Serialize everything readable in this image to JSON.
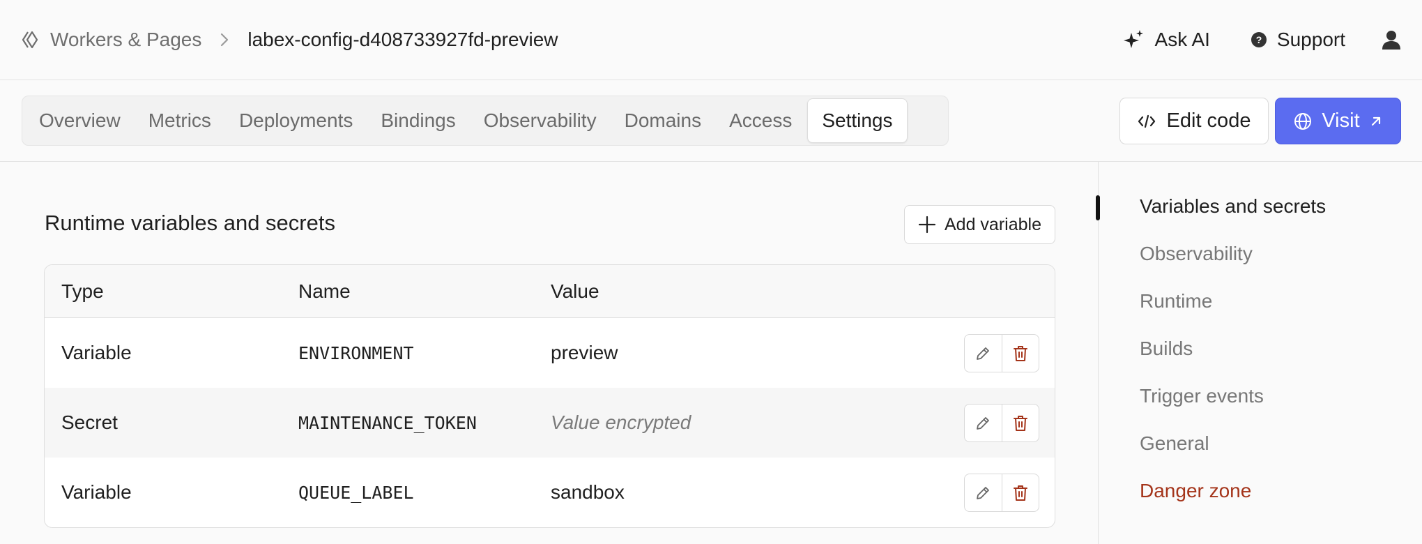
{
  "breadcrumb": {
    "section": "Workers & Pages",
    "project": "labex-config-d408733927fd-preview"
  },
  "top_actions": {
    "ask_ai": "Ask AI",
    "support": "Support"
  },
  "tabs": [
    {
      "label": "Overview"
    },
    {
      "label": "Metrics"
    },
    {
      "label": "Deployments"
    },
    {
      "label": "Bindings"
    },
    {
      "label": "Observability"
    },
    {
      "label": "Domains"
    },
    {
      "label": "Access"
    },
    {
      "label": "Settings"
    }
  ],
  "toolbar": {
    "edit_code": "Edit code",
    "visit": "Visit"
  },
  "variables": {
    "title": "Runtime variables and secrets",
    "add_label": "Add variable",
    "columns": {
      "type": "Type",
      "name": "Name",
      "value": "Value"
    },
    "rows": [
      {
        "type": "Variable",
        "name": "ENVIRONMENT",
        "value": "preview"
      },
      {
        "type": "Secret",
        "name": "MAINTENANCE_TOKEN",
        "value": "Value encrypted"
      },
      {
        "type": "Variable",
        "name": "QUEUE_LABEL",
        "value": "sandbox"
      }
    ]
  },
  "right_nav": {
    "items": [
      {
        "label": "Variables and secrets"
      },
      {
        "label": "Observability"
      },
      {
        "label": "Runtime"
      },
      {
        "label": "Builds"
      },
      {
        "label": "Trigger events"
      },
      {
        "label": "General"
      },
      {
        "label": "Danger zone"
      }
    ]
  },
  "colors": {
    "accent": "#5b6cf0",
    "danger": "#a4341a",
    "active_indicator": "#111111"
  }
}
